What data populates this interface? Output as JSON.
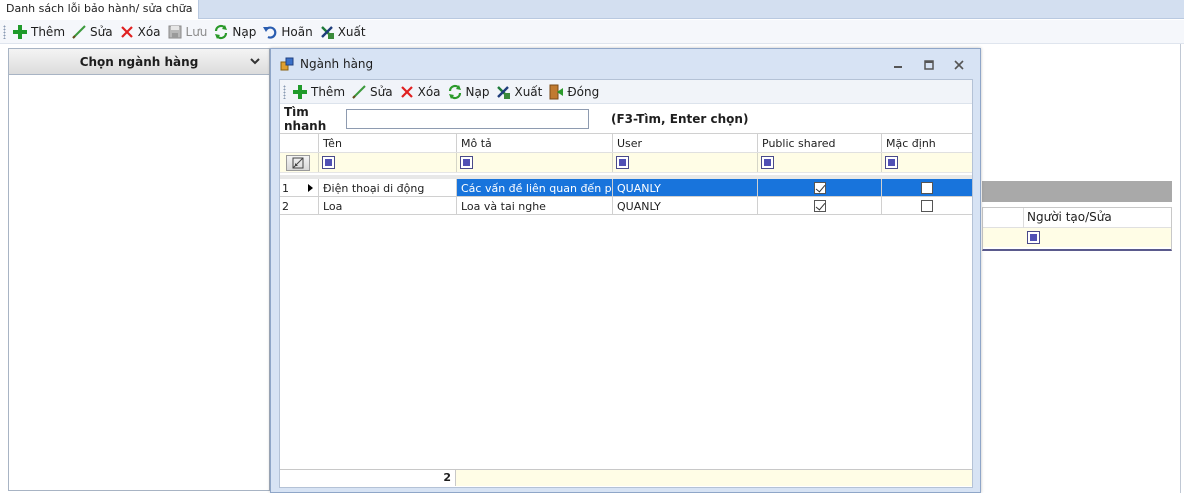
{
  "window": {
    "tab_title": "Danh sách lỗi bảo hành/ sửa chữa"
  },
  "main_toolbar": {
    "add_label": "Thêm",
    "edit_label": "Sửa",
    "delete_label": "Xóa",
    "save_label": "Lưu",
    "reload_label": "Nạp",
    "undo_label": "Hoãn",
    "export_label": "Xuất"
  },
  "left_panel": {
    "header": "Chọn ngành hàng"
  },
  "background_grid": {
    "creator_column": "Người tạo/Sửa"
  },
  "dialog": {
    "title": "Ngành hàng",
    "toolbar": {
      "add_label": "Thêm",
      "edit_label": "Sửa",
      "delete_label": "Xóa",
      "reload_label": "Nạp",
      "export_label": "Xuất",
      "close_label": "Đóng"
    },
    "quick_search": {
      "label": "Tìm nhanh",
      "value": "",
      "hint": "(F3-Tìm, Enter chọn)"
    },
    "columns": [
      "Tên",
      "Mô tả",
      "User",
      "Public shared",
      "Mặc định"
    ],
    "rows": [
      {
        "num": "1",
        "name": "Điện thoại di động",
        "desc": "Các vấn đề liên quan đến p...",
        "user": "QUANLY",
        "public_shared": true,
        "default": false
      },
      {
        "num": "2",
        "name": "Loa",
        "desc": "Loa và tai nghe",
        "user": "QUANLY",
        "public_shared": true,
        "default": false
      }
    ],
    "footer_count": "2"
  },
  "colors": {
    "selection": "#1874dc",
    "filter_row": "#fffde6",
    "dialog_frame": "#d7e3f4"
  }
}
